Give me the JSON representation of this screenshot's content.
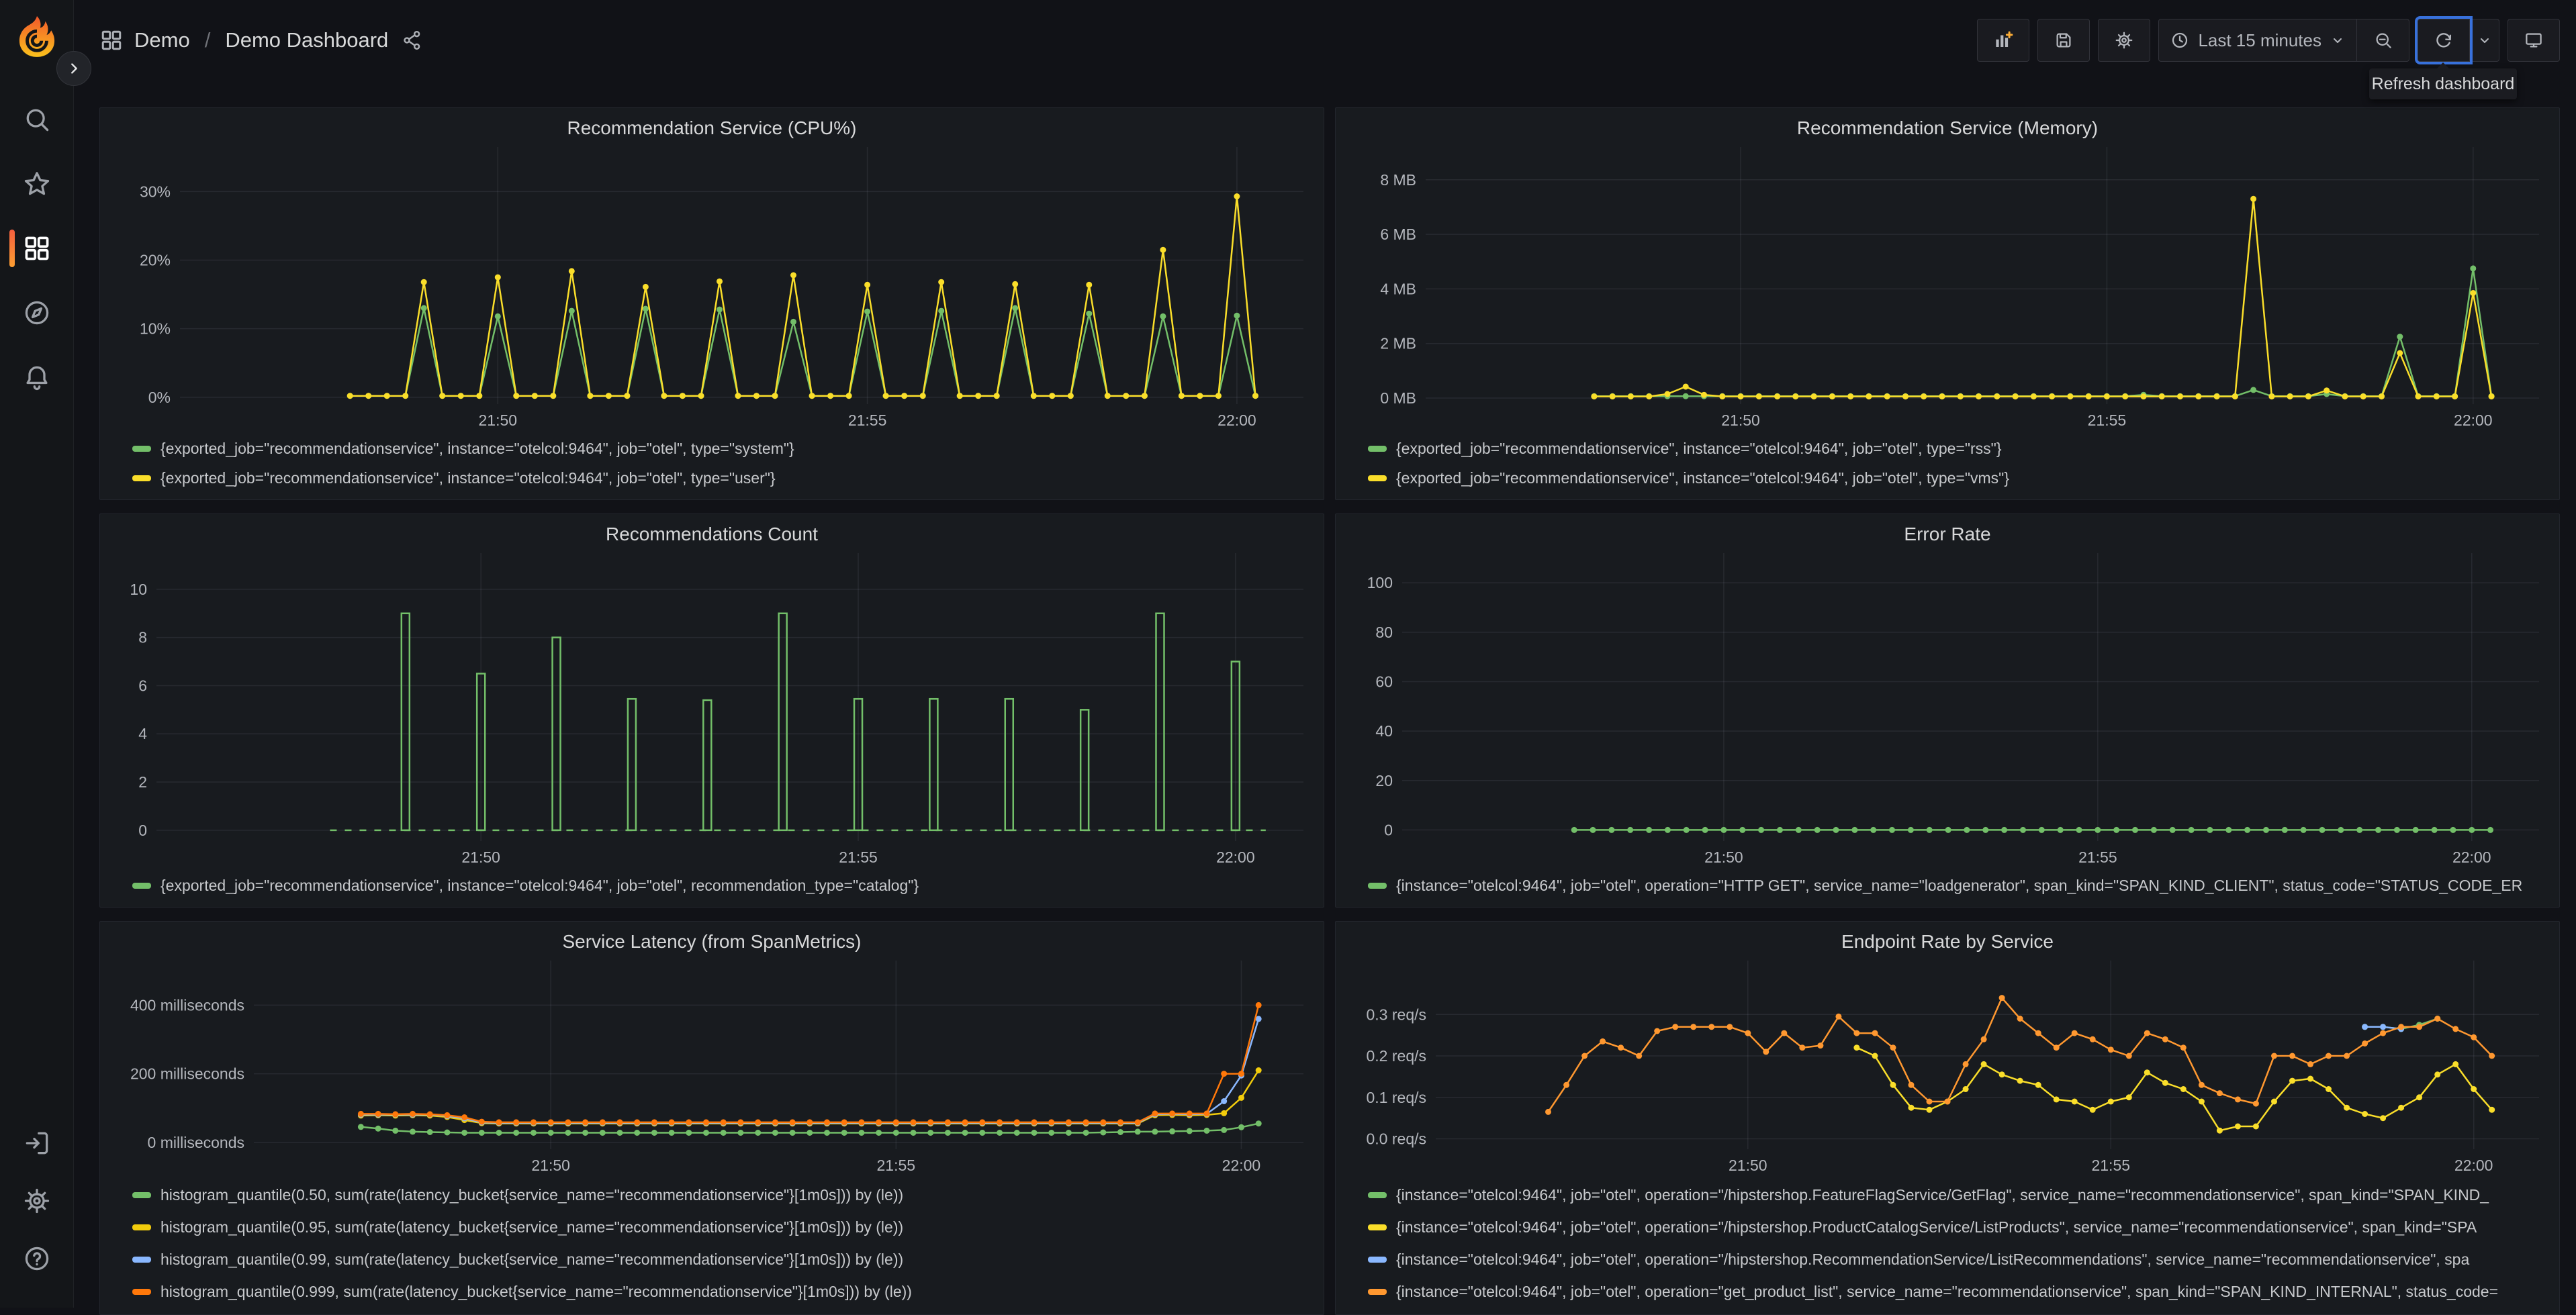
{
  "nav": {
    "breadcrumb": {
      "section": "Demo",
      "separator": "/",
      "page": "Demo Dashboard"
    },
    "time_range": "Last 15 minutes",
    "tooltip": "Refresh dashboard",
    "icons": [
      "apps-grid-icon",
      "share-alt-icon",
      "add-panel-icon",
      "save-dashboard-icon",
      "dashboard-settings-icon",
      "clock-icon",
      "chevron-down-icon",
      "zoom-out-icon",
      "refresh-icon",
      "kiosk-monitor-icon"
    ],
    "accent_focus_color": "#3871dc"
  },
  "sidebar": {
    "items": [
      "search",
      "starred",
      "dashboards",
      "explore",
      "alerting"
    ],
    "active_item": "dashboards",
    "bottom_items": [
      "sign-in",
      "settings",
      "help"
    ],
    "active_indicator_colors": [
      "#f55f3e",
      "#fc9f32"
    ]
  },
  "chart_data": [
    {
      "type": "line",
      "title": "Recommendation Service (CPU%)",
      "xlim": [
        45.7,
        60.9
      ],
      "x_ticks": [
        {
          "t": 50,
          "label": "21:50"
        },
        {
          "t": 55,
          "label": "21:55"
        },
        {
          "t": 60,
          "label": "22:00"
        }
      ],
      "ylim": [
        -1,
        36.5
      ],
      "y_ticks": [
        {
          "v": 0,
          "label": "0%"
        },
        {
          "v": 10,
          "label": "10%"
        },
        {
          "v": 20,
          "label": "20%"
        },
        {
          "v": 30,
          "label": "30%"
        }
      ],
      "gutter": 105,
      "series": [
        {
          "name": "{exported_job=\"recommendationservice\", instance=\"otelcol:9464\", job=\"otel\", type=\"system\"}",
          "color": "#73bf69",
          "t0": 48,
          "dt": 0.25,
          "values": [
            0.2,
            0.2,
            0.2,
            0.2,
            13,
            0.2,
            0.2,
            0.2,
            11.8,
            0.2,
            0.2,
            0.2,
            12.6,
            0.2,
            0.2,
            0.2,
            12.9,
            0.2,
            0.2,
            0.2,
            12.8,
            0.2,
            0.2,
            0.2,
            11,
            0.2,
            0.2,
            0.2,
            12.5,
            0.2,
            0.2,
            0.2,
            12.6,
            0.2,
            0.2,
            0.2,
            13,
            0.2,
            0.2,
            0.2,
            12.2,
            0.2,
            0.2,
            0.2,
            11.8,
            0.2,
            0.2,
            0.2,
            11.9,
            0.2
          ]
        },
        {
          "name": "{exported_job=\"recommendationservice\", instance=\"otelcol:9464\", job=\"otel\", type=\"user\"}",
          "color": "#fade2a",
          "t0": 48,
          "dt": 0.25,
          "values": [
            0.2,
            0.2,
            0.2,
            0.2,
            16.8,
            0.2,
            0.2,
            0.2,
            17.5,
            0.2,
            0.2,
            0.2,
            18.4,
            0.2,
            0.2,
            0.2,
            16.1,
            0.2,
            0.2,
            0.2,
            16.9,
            0.2,
            0.2,
            0.2,
            17.8,
            0.2,
            0.2,
            0.2,
            16.4,
            0.2,
            0.2,
            0.2,
            16.8,
            0.2,
            0.2,
            0.2,
            16.5,
            0.2,
            0.2,
            0.2,
            16.4,
            0.2,
            0.2,
            0.2,
            21.5,
            0.2,
            0.2,
            0.2,
            29.3,
            0.2
          ]
        }
      ]
    },
    {
      "type": "line",
      "title": "Recommendation Service (Memory)",
      "xlim": [
        45.7,
        60.9
      ],
      "x_ticks": [
        {
          "t": 50,
          "label": "21:50"
        },
        {
          "t": 55,
          "label": "21:55"
        },
        {
          "t": 60,
          "label": "22:00"
        }
      ],
      "ylim": [
        -0.22,
        9.2
      ],
      "y_ticks": [
        {
          "v": 0,
          "label": "0 MB"
        },
        {
          "v": 2,
          "label": "2 MB"
        },
        {
          "v": 4,
          "label": "4 MB"
        },
        {
          "v": 6,
          "label": "6 MB"
        },
        {
          "v": 8,
          "label": "8 MB"
        }
      ],
      "gutter": 120,
      "series": [
        {
          "name": "{exported_job=\"recommendationservice\", instance=\"otelcol:9464\", job=\"otel\", type=\"rss\"}",
          "color": "#73bf69",
          "t0": 48,
          "dt": 0.25,
          "values": [
            0.07,
            0.07,
            0.07,
            0.07,
            0.07,
            0.07,
            0.07,
            0.07,
            0.07,
            0.07,
            0.07,
            0.07,
            0.07,
            0.07,
            0.07,
            0.07,
            0.07,
            0.07,
            0.07,
            0.07,
            0.07,
            0.07,
            0.07,
            0.07,
            0.07,
            0.07,
            0.07,
            0.07,
            0.07,
            0.07,
            0.12,
            0.07,
            0.07,
            0.07,
            0.07,
            0.07,
            0.3,
            0.07,
            0.07,
            0.07,
            0.15,
            0.07,
            0.07,
            0.07,
            2.25,
            0.07,
            0.07,
            0.07,
            4.75,
            0.07
          ]
        },
        {
          "name": "{exported_job=\"recommendationservice\", instance=\"otelcol:9464\", job=\"otel\", type=\"vms\"}",
          "color": "#fade2a",
          "t0": 48,
          "dt": 0.25,
          "values": [
            0.06,
            0.06,
            0.06,
            0.06,
            0.15,
            0.42,
            0.12,
            0.06,
            0.06,
            0.06,
            0.06,
            0.06,
            0.06,
            0.06,
            0.06,
            0.06,
            0.06,
            0.06,
            0.06,
            0.06,
            0.06,
            0.06,
            0.06,
            0.06,
            0.06,
            0.06,
            0.06,
            0.06,
            0.06,
            0.06,
            0.06,
            0.06,
            0.06,
            0.06,
            0.06,
            0.06,
            7.3,
            0.06,
            0.06,
            0.06,
            0.28,
            0.06,
            0.06,
            0.06,
            1.65,
            0.06,
            0.06,
            0.06,
            3.85,
            0.06
          ]
        }
      ]
    },
    {
      "type": "bar",
      "title": "Recommendations Count",
      "xlim": [
        45.7,
        60.9
      ],
      "x_ticks": [
        {
          "t": 50,
          "label": "21:50"
        },
        {
          "t": 55,
          "label": "21:55"
        },
        {
          "t": 60,
          "label": "22:00"
        }
      ],
      "ylim": [
        -0.45,
        11.5
      ],
      "y_ticks": [
        {
          "v": 0,
          "label": "0"
        },
        {
          "v": 2,
          "label": "2"
        },
        {
          "v": 4,
          "label": "4"
        },
        {
          "v": 6,
          "label": "6"
        },
        {
          "v": 8,
          "label": "8"
        },
        {
          "v": 10,
          "label": "10"
        }
      ],
      "gutter": 70,
      "series": [
        {
          "name": "{exported_job=\"recommendationservice\", instance=\"otelcol:9464\", job=\"otel\", recommendation_type=\"catalog\"}",
          "color": "#73bf69",
          "style": "pulse",
          "baseline": [
            48.0,
            60.4
          ],
          "pulses": [
            [
              49,
              9
            ],
            [
              50,
              6.5
            ],
            [
              51,
              8
            ],
            [
              52,
              5.45
            ],
            [
              53,
              5.4
            ],
            [
              54,
              9
            ],
            [
              55,
              5.45
            ],
            [
              56,
              5.45
            ],
            [
              57,
              5.45
            ],
            [
              58,
              5
            ],
            [
              59,
              9
            ],
            [
              60,
              7
            ]
          ]
        }
      ]
    },
    {
      "type": "line",
      "title": "Error Rate",
      "xlim": [
        45.7,
        60.9
      ],
      "x_ticks": [
        {
          "t": 50,
          "label": "21:50"
        },
        {
          "t": 55,
          "label": "21:55"
        },
        {
          "t": 60,
          "label": "22:00"
        }
      ],
      "ylim": [
        -4.5,
        112
      ],
      "y_ticks": [
        {
          "v": 0,
          "label": "0"
        },
        {
          "v": 20,
          "label": "20"
        },
        {
          "v": 40,
          "label": "40"
        },
        {
          "v": 60,
          "label": "60"
        },
        {
          "v": 80,
          "label": "80"
        },
        {
          "v": 100,
          "label": "100"
        }
      ],
      "gutter": 85,
      "series": [
        {
          "name": "{instance=\"otelcol:9464\", job=\"otel\", operation=\"HTTP GET\", service_name=\"loadgenerator\", span_kind=\"SPAN_KIND_CLIENT\", status_code=\"STATUS_CODE_ER",
          "color": "#73bf69",
          "t0": 48,
          "dt": 0.25,
          "n": 50,
          "const": 0
        }
      ]
    },
    {
      "type": "line",
      "title": "Service Latency (from SpanMetrics)",
      "xlim": [
        45.7,
        60.9
      ],
      "x_ticks": [
        {
          "t": 50,
          "label": "21:50"
        },
        {
          "t": 55,
          "label": "21:55"
        },
        {
          "t": 60,
          "label": "22:00"
        }
      ],
      "ylim": [
        -20,
        530
      ],
      "y_ticks": [
        {
          "v": 0,
          "label": "0 milliseconds"
        },
        {
          "v": 200,
          "label": "200 milliseconds"
        },
        {
          "v": 400,
          "label": "400 milliseconds"
        }
      ],
      "gutter": 215,
      "series": [
        {
          "name": "histogram_quantile(0.50, sum(rate(latency_bucket{service_name=\"recommendationservice\"}[1m0s])) by (le))",
          "color": "#73bf69",
          "t0": 47.25,
          "dt": 0.25,
          "values": [
            45,
            40,
            34,
            31,
            30,
            29,
            28,
            28,
            28,
            28,
            28,
            28,
            28,
            28,
            28,
            28,
            28,
            28,
            28,
            28,
            28,
            28,
            28,
            28,
            28,
            28,
            28,
            28,
            28,
            28,
            28,
            28,
            28,
            28,
            28,
            28,
            28,
            28,
            28,
            28,
            28,
            28,
            28,
            29,
            30,
            31,
            31,
            32,
            33,
            34,
            36,
            44,
            55
          ]
        },
        {
          "name": "histogram_quantile(0.95, sum(rate(latency_bucket{service_name=\"recommendationservice\"}[1m0s])) by (le))",
          "color": "#f2cc0c",
          "t0": 47.25,
          "dt": 0.25,
          "values": [
            78,
            79,
            78,
            79,
            78,
            74,
            65,
            56,
            55,
            55,
            55,
            55,
            55,
            55,
            55,
            55,
            55,
            55,
            55,
            55,
            55,
            55,
            55,
            55,
            55,
            55,
            55,
            55,
            55,
            55,
            55,
            55,
            55,
            55,
            55,
            55,
            55,
            55,
            55,
            55,
            55,
            55,
            55,
            55,
            55,
            55,
            79,
            80,
            79,
            80,
            85,
            130,
            210
          ]
        },
        {
          "name": "histogram_quantile(0.99, sum(rate(latency_bucket{service_name=\"recommendationservice\"}[1m0s])) by (le))",
          "color": "#8ab8ff",
          "t0": 47.25,
          "dt": 0.25,
          "values": [
            81,
            81,
            81,
            81,
            81,
            77,
            70,
            58,
            57,
            57,
            57,
            57,
            57,
            57,
            57,
            57,
            57,
            57,
            57,
            57,
            57,
            57,
            57,
            57,
            57,
            57,
            57,
            57,
            57,
            57,
            57,
            57,
            57,
            57,
            57,
            57,
            57,
            57,
            57,
            57,
            57,
            57,
            57,
            57,
            57,
            57,
            82,
            83,
            82,
            83,
            120,
            195,
            360
          ]
        },
        {
          "name": "histogram_quantile(0.999, sum(rate(latency_bucket{service_name=\"recommendationservice\"}[1m0s])) by (le))",
          "color": "#ff780a",
          "t0": 47.25,
          "dt": 0.25,
          "values": [
            83,
            83,
            82,
            83,
            82,
            79,
            73,
            60,
            58.5,
            58.5,
            58.5,
            58.5,
            58.5,
            58.5,
            58.5,
            58.5,
            58.5,
            58.5,
            58.5,
            58.5,
            58.5,
            58.5,
            58.5,
            58.5,
            58.5,
            58.5,
            58.5,
            58.5,
            58.5,
            58.5,
            58.5,
            58.5,
            58.5,
            58.5,
            58.5,
            58.5,
            58.5,
            58.5,
            58.5,
            58.5,
            58.5,
            58.5,
            58.5,
            58.5,
            58.5,
            58.5,
            84,
            84,
            84,
            84,
            200,
            200,
            400
          ]
        }
      ]
    },
    {
      "type": "line",
      "title": "Endpoint Rate by Service",
      "xlim": [
        45.7,
        60.9
      ],
      "x_ticks": [
        {
          "t": 50,
          "label": "21:50"
        },
        {
          "t": 55,
          "label": "21:55"
        },
        {
          "t": 60,
          "label": "22:00"
        }
      ],
      "ylim": [
        -0.025,
        0.43
      ],
      "y_ticks": [
        {
          "v": 0,
          "label": "0.0 req/s"
        },
        {
          "v": 0.1,
          "label": "0.1 req/s"
        },
        {
          "v": 0.2,
          "label": "0.2 req/s"
        },
        {
          "v": 0.3,
          "label": "0.3 req/s"
        }
      ],
      "gutter": 135,
      "series": [
        {
          "name": "{instance=\"otelcol:9464\", job=\"otel\", operation=\"/hipstershop.FeatureFlagService/GetFlag\", service_name=\"recommendationservice\", span_kind=\"SPAN_KIND_",
          "color": "#73bf69",
          "t0": 58.5,
          "dt": 0.25,
          "values": [
            0.27,
            0.27,
            0.265,
            0.275,
            0.29
          ]
        },
        {
          "name": "{instance=\"otelcol:9464\", job=\"otel\", operation=\"/hipstershop.ProductCatalogService/ListProducts\", service_name=\"recommendationservice\", span_kind=\"SPA",
          "color": "#fade2a",
          "t0": 51.5,
          "dt": 0.25,
          "values": [
            0.22,
            0.2,
            0.13,
            0.075,
            0.07,
            0.09,
            0.12,
            0.18,
            0.155,
            0.14,
            0.13,
            0.095,
            0.09,
            0.07,
            0.09,
            0.1,
            0.16,
            0.135,
            0.12,
            0.09,
            0.02,
            0.03,
            0.03,
            0.09,
            0.14,
            0.145,
            0.12,
            0.075,
            0.06,
            0.05,
            0.075,
            0.1,
            0.155,
            0.18,
            0.12,
            0.07
          ]
        },
        {
          "name": "{instance=\"otelcol:9464\", job=\"otel\", operation=\"/hipstershop.RecommendationService/ListRecommendations\", service_name=\"recommendationservice\", spa",
          "color": "#8ab8ff",
          "t0": 58.5,
          "dt": 0.25,
          "values": [
            0.27,
            0.27,
            0.265
          ]
        },
        {
          "name": "{instance=\"otelcol:9464\", job=\"otel\", operation=\"get_product_list\", service_name=\"recommendationservice\", span_kind=\"SPAN_KIND_INTERNAL\", status_code=",
          "color": "#ff9830",
          "t0": 47.25,
          "dt": 0.25,
          "values": [
            0.065,
            0.13,
            0.2,
            0.235,
            0.22,
            0.2,
            0.26,
            0.27,
            0.27,
            0.27,
            0.27,
            0.255,
            0.21,
            0.255,
            0.22,
            0.225,
            0.295,
            0.255,
            0.255,
            0.22,
            0.13,
            0.09,
            0.09,
            0.18,
            0.24,
            0.34,
            0.29,
            0.255,
            0.22,
            0.255,
            0.24,
            0.215,
            0.2,
            0.255,
            0.24,
            0.22,
            0.13,
            0.11,
            0.095,
            0.085,
            0.2,
            0.2,
            0.18,
            0.2,
            0.2,
            0.23,
            0.255,
            0.27,
            0.27,
            0.29,
            0.265,
            0.245,
            0.2
          ]
        }
      ]
    }
  ]
}
